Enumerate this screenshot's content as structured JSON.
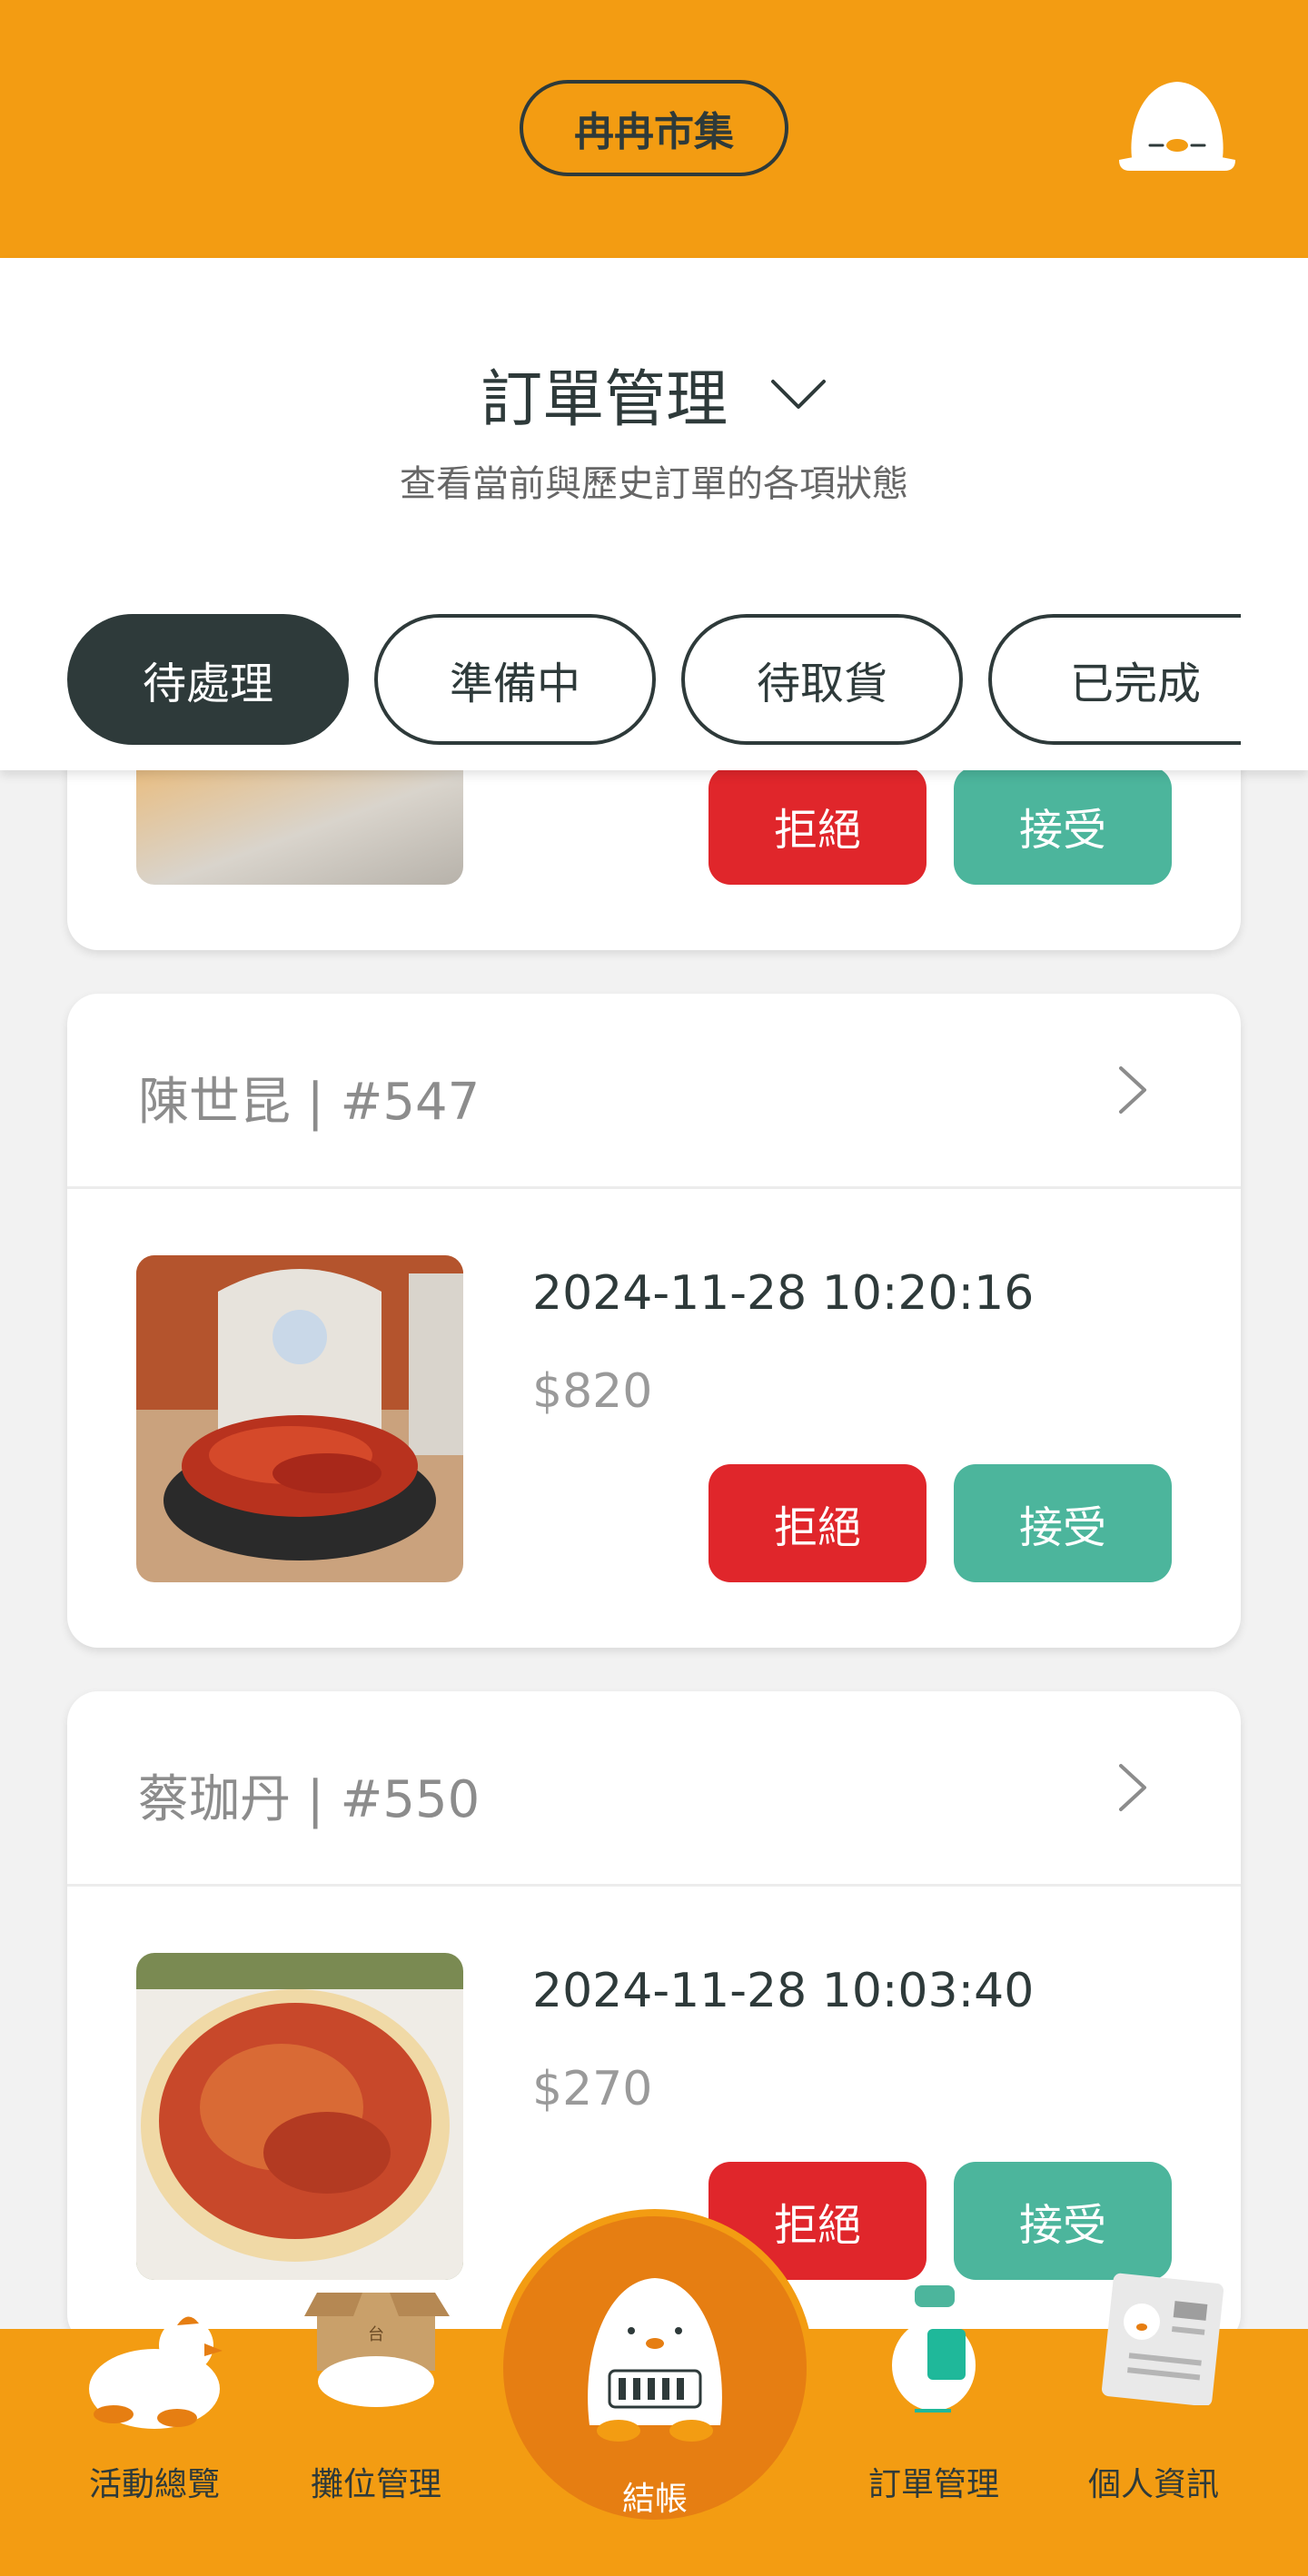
{
  "header": {
    "brand": "冉冉市集"
  },
  "title_panel": {
    "title": "訂單管理",
    "subtitle": "查看當前與歷史訂單的各項狀態"
  },
  "tabs": [
    {
      "label": "待處理",
      "active": true
    },
    {
      "label": "準備中",
      "active": false
    },
    {
      "label": "待取貨",
      "active": false
    },
    {
      "label": "已完成",
      "active": false
    }
  ],
  "orders": [
    {
      "customer": "",
      "datetime": "",
      "price": "",
      "reject_label": "拒絕",
      "accept_label": "接受"
    },
    {
      "customer": "陳世昆 | #547",
      "datetime": "2024-11-28 10:20:16",
      "price": "$820",
      "reject_label": "拒絕",
      "accept_label": "接受"
    },
    {
      "customer": "蔡珈丹 | #550",
      "datetime": "2024-11-28 10:03:40",
      "price": "$270",
      "reject_label": "拒絕",
      "accept_label": "接受"
    }
  ],
  "bottom_nav": {
    "items": [
      {
        "label": "活動總覽",
        "icon": "duck-mascot-icon"
      },
      {
        "label": "攤位管理",
        "icon": "box-mascot-icon"
      },
      {
        "label": "結帳",
        "icon": "checkout-mascot-icon"
      },
      {
        "label": "訂單管理",
        "icon": "order-mascot-icon"
      },
      {
        "label": "個人資訊",
        "icon": "newspaper-mascot-icon"
      }
    ]
  },
  "colors": {
    "brand": "#f39c12",
    "dark": "#2e3a3a",
    "reject": "#e0262b",
    "accept": "#4cb59c"
  }
}
